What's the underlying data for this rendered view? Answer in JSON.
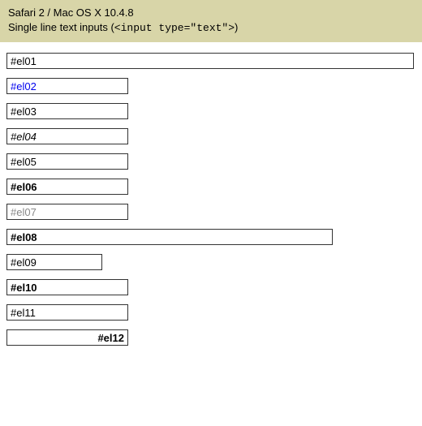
{
  "header": {
    "line1": "Safari 2 / Mac OS X 10.4.8",
    "line2_prefix": "Single line text inputs (",
    "line2_code": "<input type=\"text\">",
    "line2_suffix": ")"
  },
  "inputs": {
    "el01": "#el01",
    "el02": "#el02",
    "el03": "#el03",
    "el04": "#el04",
    "el05": "#el05",
    "el06": "#el06",
    "el07": "#el07",
    "el08": "#el08",
    "el09": "#el09",
    "el10": "#el10",
    "el11": "#el11",
    "el12": "#el12"
  }
}
